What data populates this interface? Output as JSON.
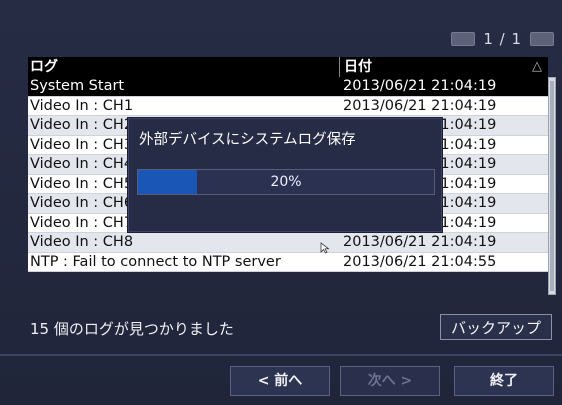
{
  "pager": {
    "text": "1 / 1"
  },
  "table": {
    "headers": {
      "log": "ログ",
      "date": "日付",
      "sort_indicator": "△"
    },
    "rows": [
      {
        "log": "System Start",
        "date": "2013/06/21 21:04:19",
        "selected": true
      },
      {
        "log": "Video In : CH1",
        "date": "2013/06/21 21:04:19"
      },
      {
        "log": "Video In : CH2",
        "date": "2013/06/21 21:04:19"
      },
      {
        "log": "Video In : CH3",
        "date": "2013/06/21 21:04:19"
      },
      {
        "log": "Video In : CH4",
        "date": "2013/06/21 21:04:19"
      },
      {
        "log": "Video In : CH5",
        "date": "2013/06/21 21:04:19"
      },
      {
        "log": "Video In : CH6",
        "date": "2013/06/21 21:04:19"
      },
      {
        "log": "Video In : CH7",
        "date": "2013/06/21 21:04:19"
      },
      {
        "log": "Video In : CH8",
        "date": "2013/06/21 21:04:19"
      },
      {
        "log": "NTP : Fail to connect to NTP server",
        "date": "2013/06/21 21:04:55"
      }
    ]
  },
  "footer": {
    "count_text": "15 個のログが見つかりました",
    "backup_label": "バックアップ",
    "prev_label": "< 前へ",
    "next_label": "次へ >",
    "end_label": "終了"
  },
  "modal": {
    "title": "外部デバイスにシステムログ保存",
    "progress_percent": 20,
    "progress_text": "20%"
  },
  "colors": {
    "background": "#23293f",
    "progress_fill": "#1a56b5",
    "selected_row": "#000000"
  }
}
